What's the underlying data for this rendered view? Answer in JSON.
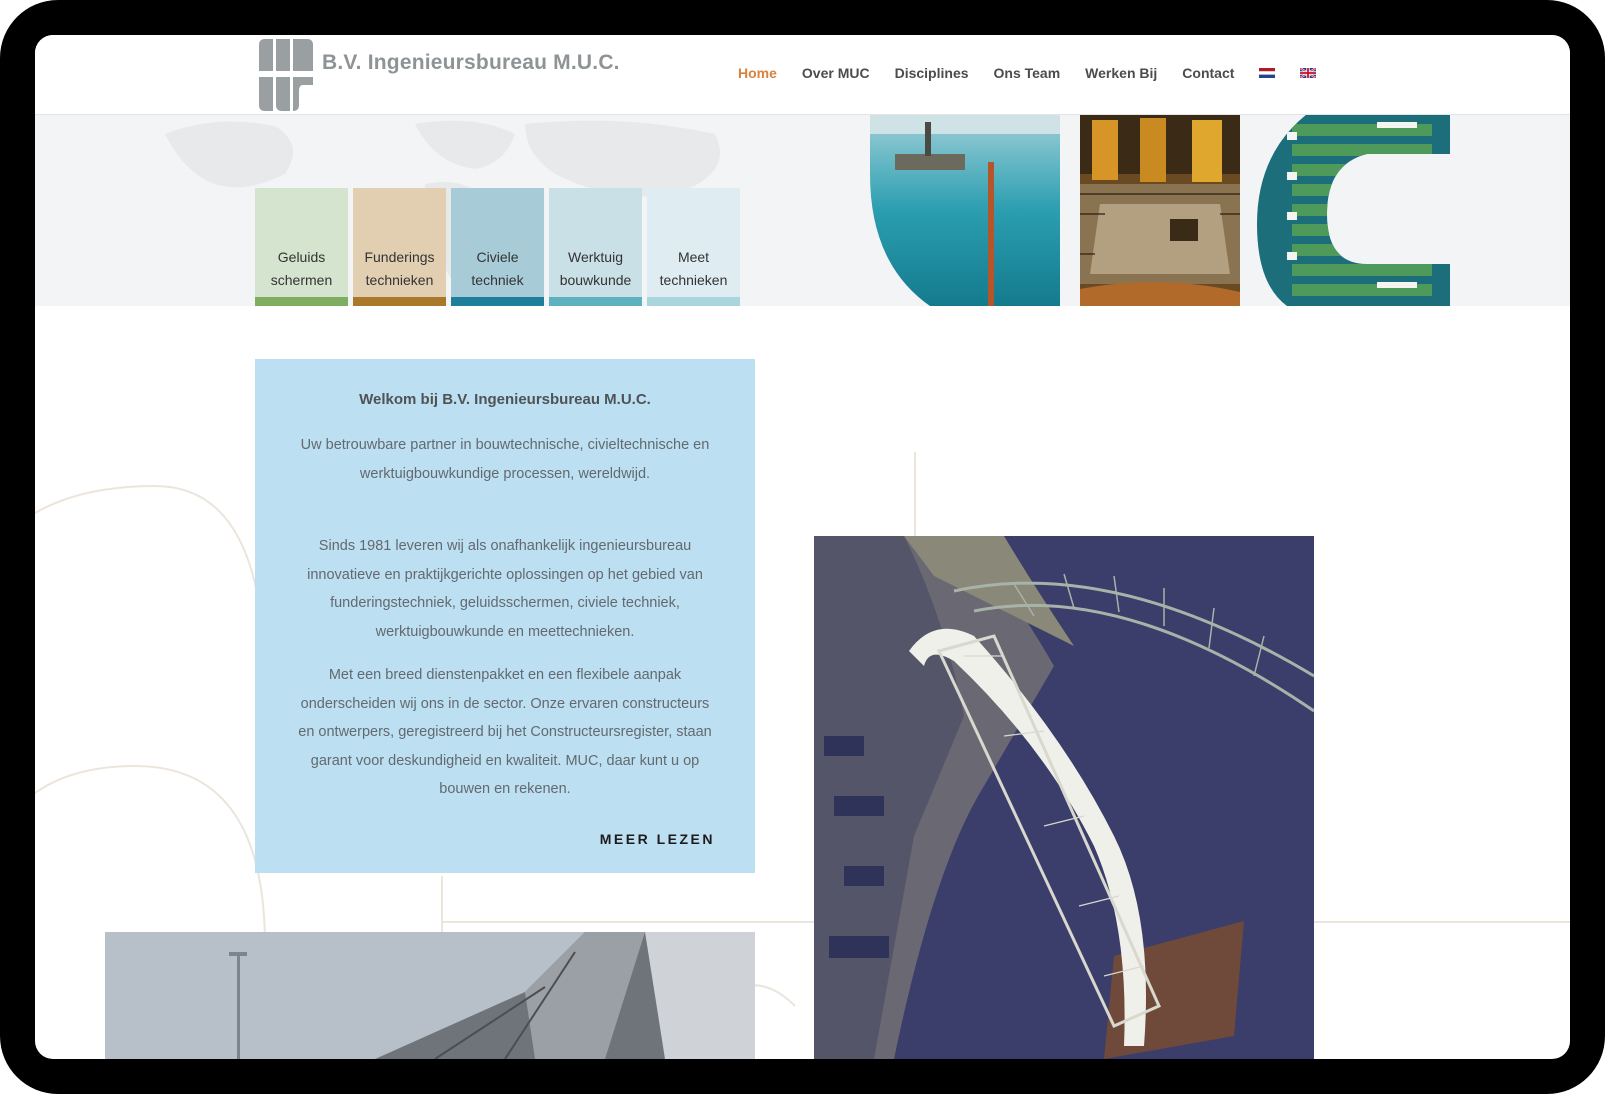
{
  "header": {
    "logo_text": "B.V. Ingenieursbureau M.U.C.",
    "nav": [
      {
        "label": "Home",
        "active": true
      },
      {
        "label": "Over MUC"
      },
      {
        "label": "Disciplines"
      },
      {
        "label": "Ons Team"
      },
      {
        "label": "Werken Bij"
      },
      {
        "label": "Contact"
      }
    ],
    "accent_color": "#d9823e"
  },
  "hero": {
    "tiles": [
      {
        "line1": "Geluids",
        "line2": "schermen",
        "bg": "#d5e4cf",
        "bar": "#7fae62"
      },
      {
        "line1": "Funderings",
        "line2": "technieken",
        "bg": "#e2cfb2",
        "bar": "#a9782b"
      },
      {
        "line1": "Civiele",
        "line2": "techniek",
        "bg": "#a8cbd8",
        "bar": "#1f7e9a"
      },
      {
        "line1": "Werktuig",
        "line2": "bouwkunde",
        "bg": "#c9e0e6",
        "bar": "#5eb2c0"
      },
      {
        "line1": "Meet",
        "line2": "technieken",
        "bg": "#dfecf1",
        "bar": "#a9d5dd"
      }
    ]
  },
  "welcome": {
    "title": "Welkom bij B.V. Ingenieursbureau M.U.C.",
    "p1": "Uw betrouwbare partner in bouwtechnische, civieltechnische en werktuigbouwkundige processen, wereldwijd.",
    "p2": "Sinds 1981 leveren wij als onafhankelijk ingenieursbureau innovatieve en praktijkgerichte oplossingen op het gebied van funderingstechniek, geluidsschermen, civiele techniek, werktuigbouwkunde en meettechnieken.",
    "p3": "Met een breed dienstenpakket en een flexibele aanpak onderscheiden wij ons in de sector. Onze ervaren constructeurs en ontwerpers, geregistreerd bij het Constructeursregister, staan garant voor deskundigheid en kwaliteit. MUC, daar kunt u op bouwen en rekenen.",
    "read_more": "MEER LEZEN"
  }
}
